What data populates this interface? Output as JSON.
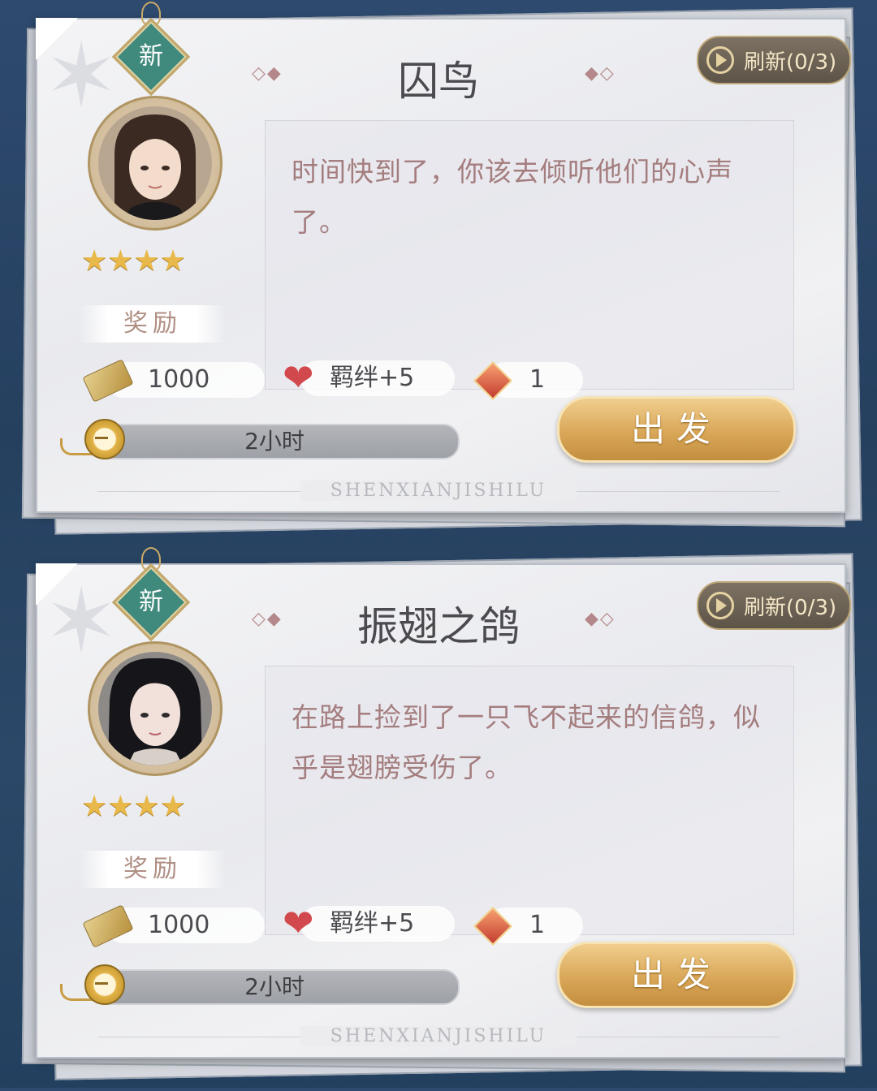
{
  "cards": [
    {
      "badge": "新",
      "title": "囚鸟",
      "title_deco_left": "◇◆",
      "title_deco_right": "◆◇",
      "refresh_label": "刷新(0/3)",
      "stars": "★★★★",
      "description": "时间快到了，你该去倾听他们的心声了。",
      "reward_label": "奖励",
      "rewards": {
        "currency": "1000",
        "bond": "羁绊+5",
        "gem": "1"
      },
      "duration": "2小时",
      "go_label": "出发",
      "footer": "SHENXIANJISHILU",
      "avatar": {
        "hair": "#3b2a22",
        "skin": "#f3dccb"
      }
    },
    {
      "badge": "新",
      "title": "振翅之鸽",
      "title_deco_left": "◇◆",
      "title_deco_right": "◆◇",
      "refresh_label": "刷新(0/3)",
      "stars": "★★★★",
      "description": "在路上捡到了一只飞不起来的信鸽，似乎是翅膀受伤了。",
      "reward_label": "奖励",
      "rewards": {
        "currency": "1000",
        "bond": "羁绊+5",
        "gem": "1"
      },
      "duration": "2小时",
      "go_label": "出发",
      "footer": "SHENXIANJISHILU",
      "avatar": {
        "hair": "#16161a",
        "skin": "#f1e1da"
      }
    }
  ],
  "colors": {
    "accent_gold": "#d9a758",
    "badge_green": "#3f8a7c",
    "desc_text": "#a47d7e"
  }
}
